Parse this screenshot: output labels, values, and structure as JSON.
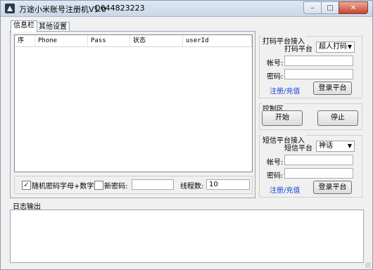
{
  "window": {
    "title": "万途小米账号注册机V1.0",
    "qq": "Q644823223"
  },
  "tabs": [
    "信息栏",
    "其他设置"
  ],
  "table": {
    "columns": [
      "序",
      "Phone",
      "Pass",
      "状态",
      "userId"
    ]
  },
  "options": {
    "random_pwd_label": "随机密码字母+数字",
    "random_pwd_checked": true,
    "new_pwd_label": "新密码:",
    "new_pwd_checked": false,
    "new_pwd_value": "",
    "threads_label": "线程数:",
    "threads_value": "10"
  },
  "captcha": {
    "group_title": "打码平台接入",
    "platform_label": "打码平台",
    "platform_value": "超人打码",
    "account_label": "帐号:",
    "password_label": "密码:",
    "register_link": "注册/充值",
    "login_button": "登录平台"
  },
  "control": {
    "group_title": "控制区",
    "start_button": "开始",
    "stop_button": "停止"
  },
  "sms": {
    "group_title": "短信平台接入",
    "platform_label": "短信平台",
    "platform_value": "神话",
    "account_label": "帐号:",
    "password_label": "密码:",
    "register_link": "注册/充值",
    "login_button": "登录平台"
  },
  "log": {
    "title": "日志输出"
  },
  "icons": {
    "app": "app-logo-icon",
    "minimize": "minimize-icon",
    "maximize": "maximize-icon",
    "close": "close-icon",
    "dropdown": "chevron-down-icon",
    "check": "checkmark-icon"
  }
}
